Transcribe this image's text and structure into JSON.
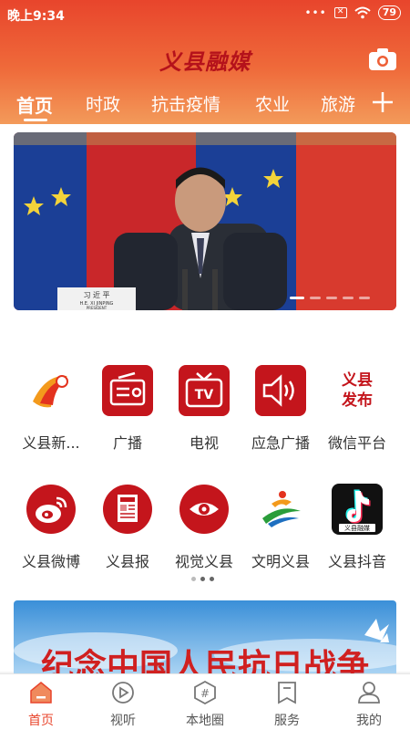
{
  "status_bar": {
    "time": "晚上9:34",
    "signal_dots": "•••",
    "sim_icon": "sim-x-icon",
    "wifi_icon": "wifi-icon",
    "battery": "79"
  },
  "header": {
    "brand": "义县融媒",
    "camera_icon": "camera-icon",
    "more_icon": "plus-icon"
  },
  "tabs": [
    {
      "label": "首页",
      "active": true
    },
    {
      "label": "时政",
      "active": false
    },
    {
      "label": "抗击疫情",
      "active": false
    },
    {
      "label": "农业",
      "active": false
    },
    {
      "label": "旅游",
      "active": false
    }
  ],
  "banner": {
    "nameplate": "习 近 平",
    "nameplate_sub": "H.E. XI JINPING",
    "nameplate_title": "PRESIDENT",
    "slides": 5,
    "current": 1
  },
  "grid_row1": [
    {
      "label": "义县新...",
      "icon": "yixian-news-logo-icon"
    },
    {
      "label": "广播",
      "icon": "radio-icon"
    },
    {
      "label": "电视",
      "icon": "tv-icon"
    },
    {
      "label": "应急广播",
      "icon": "emergency-broadcast-icon"
    },
    {
      "label": "微信平台",
      "icon": "yixian-fabu-icon",
      "icon_text": "义县\n发布"
    }
  ],
  "grid_row2": [
    {
      "label": "义县微博",
      "icon": "weibo-icon"
    },
    {
      "label": "义县报",
      "icon": "newspaper-icon"
    },
    {
      "label": "视觉义县",
      "icon": "eye-icon"
    },
    {
      "label": "文明义县",
      "icon": "civilization-logo-icon"
    },
    {
      "label": "义县抖音",
      "icon": "douyin-icon",
      "icon_text": "义县融媒"
    }
  ],
  "page_indicator": {
    "pages": 3,
    "current": 2
  },
  "banner2": {
    "text": "纪念中国人民抗日战争"
  },
  "bottom_nav": [
    {
      "label": "首页",
      "icon": "home-icon",
      "active": true
    },
    {
      "label": "视听",
      "icon": "play-icon",
      "active": false
    },
    {
      "label": "本地圈",
      "icon": "hashtag-icon",
      "active": false
    },
    {
      "label": "服务",
      "icon": "bookmark-icon",
      "active": false
    },
    {
      "label": "我的",
      "icon": "profile-icon",
      "active": false
    }
  ],
  "colors": {
    "accent": "#e8452c",
    "brand_red": "#b5121b",
    "icon_red": "#c4151c"
  }
}
